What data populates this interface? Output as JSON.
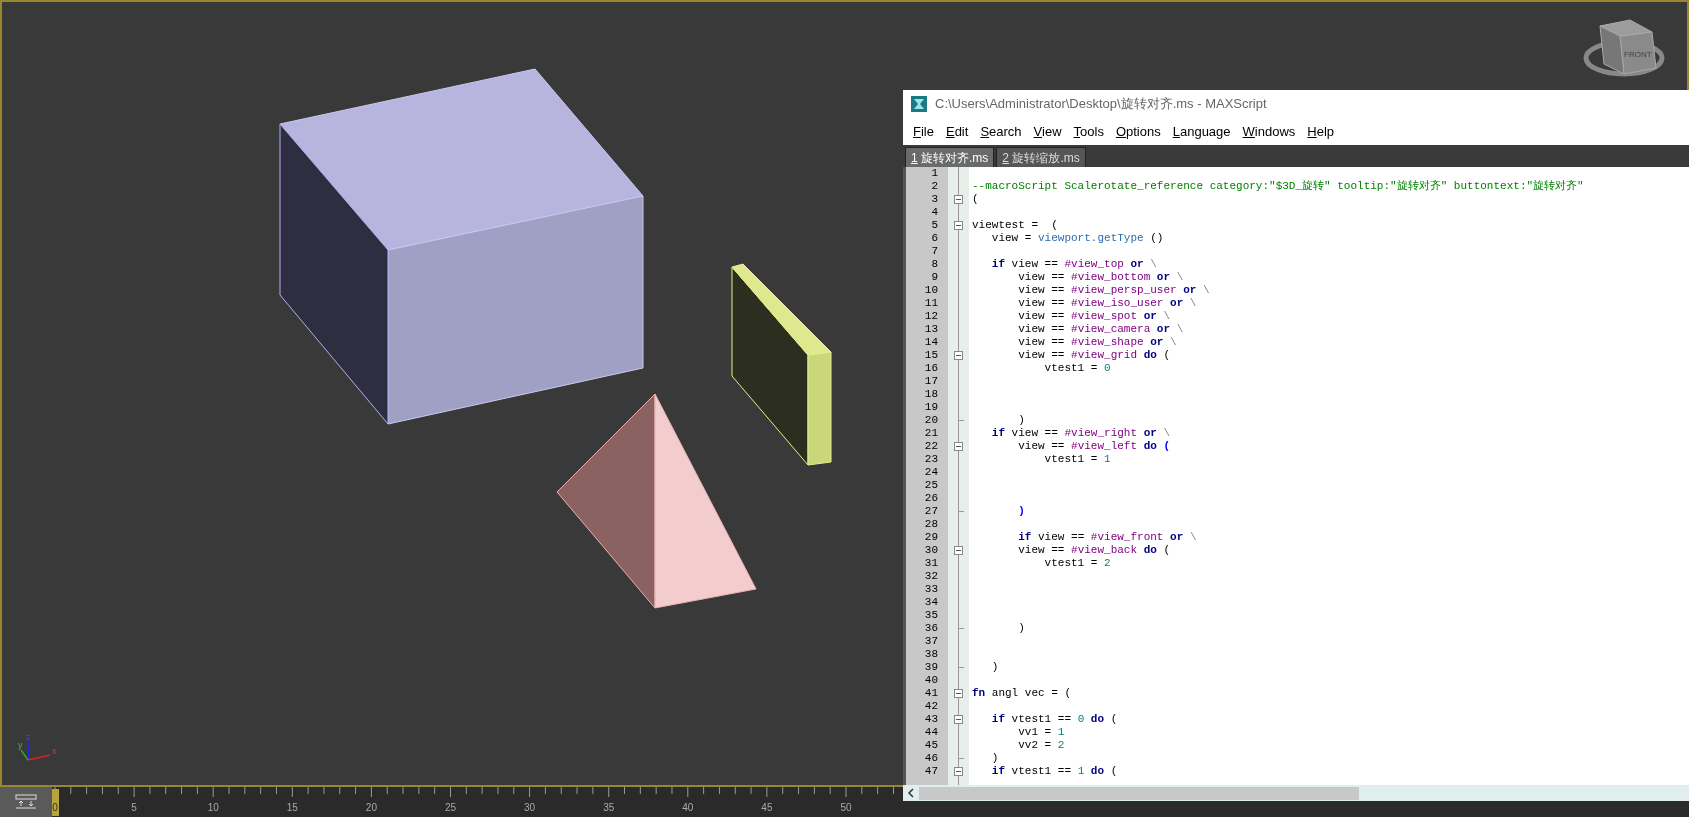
{
  "viewport": {
    "viewcube_label": "FRONT",
    "axis_labels": [
      "z",
      "y",
      "x"
    ]
  },
  "timeline": {
    "frame_labels": [
      "0",
      "5",
      "10",
      "15",
      "20",
      "25",
      "30",
      "35",
      "40",
      "45",
      "50"
    ],
    "time_slider": {
      "level": 0
    }
  },
  "editor": {
    "title": "C:\\Users\\Administrator\\Desktop\\旋转对齐.ms - MAXScript",
    "menu": [
      "File",
      "Edit",
      "Search",
      "View",
      "Tools",
      "Options",
      "Language",
      "Windows",
      "Help"
    ],
    "tabs": [
      {
        "number": "1",
        "label": " 旋转对齐.ms",
        "selected": true
      },
      {
        "number": "2",
        "label": " 旋转缩放.ms",
        "selected": false
      }
    ],
    "lines": [
      {
        "number": "1",
        "kind": "plain"
      },
      {
        "number": "2",
        "kind": "plain",
        "tokens": [
          {
            "kind": "comment",
            "text": "--macroScript Scalerotate_reference category:\"$3D_旋转\" tooltip:\"旋转对齐\" buttontext:\"旋转对齐\""
          }
        ]
      },
      {
        "number": "3",
        "kind": "fold-start",
        "tokens": [
          {
            "kind": "plain",
            "text": "("
          }
        ]
      },
      {
        "number": "4",
        "kind": "plain"
      },
      {
        "number": "5",
        "kind": "fold-start",
        "tokens": [
          {
            "kind": "plain",
            "text": "viewtest =  ("
          }
        ]
      },
      {
        "number": "6",
        "kind": "plain",
        "tokens": [
          {
            "kind": "plain",
            "text": "   view = "
          },
          {
            "kind": "call",
            "text": "viewport.getType"
          },
          {
            "kind": "plain",
            "text": " ()"
          }
        ]
      },
      {
        "number": "7",
        "kind": "plain"
      },
      {
        "number": "8",
        "kind": "plain",
        "tokens": [
          {
            "kind": "keyword",
            "text": "   if"
          },
          {
            "kind": "plain",
            "text": " view == "
          },
          {
            "kind": "symbol",
            "text": "#view_top"
          },
          {
            "kind": "keyword",
            "text": " or"
          },
          {
            "kind": "escape",
            "text": " \\"
          }
        ]
      },
      {
        "number": "9",
        "kind": "plain",
        "tokens": [
          {
            "kind": "plain",
            "text": "       view == "
          },
          {
            "kind": "symbol",
            "text": "#view_bottom"
          },
          {
            "kind": "keyword",
            "text": " or"
          },
          {
            "kind": "escape",
            "text": " \\"
          }
        ]
      },
      {
        "number": "10",
        "kind": "plain",
        "tokens": [
          {
            "kind": "plain",
            "text": "       view == "
          },
          {
            "kind": "symbol",
            "text": "#view_persp_user"
          },
          {
            "kind": "keyword",
            "text": " or"
          },
          {
            "kind": "escape",
            "text": " \\"
          }
        ]
      },
      {
        "number": "11",
        "kind": "plain",
        "tokens": [
          {
            "kind": "plain",
            "text": "       view == "
          },
          {
            "kind": "symbol",
            "text": "#view_iso_user"
          },
          {
            "kind": "keyword",
            "text": " or"
          },
          {
            "kind": "escape",
            "text": " \\"
          }
        ]
      },
      {
        "number": "12",
        "kind": "plain",
        "tokens": [
          {
            "kind": "plain",
            "text": "       view == "
          },
          {
            "kind": "symbol",
            "text": "#view_spot"
          },
          {
            "kind": "keyword",
            "text": " or"
          },
          {
            "kind": "escape",
            "text": " \\"
          }
        ]
      },
      {
        "number": "13",
        "kind": "plain",
        "tokens": [
          {
            "kind": "plain",
            "text": "       view == "
          },
          {
            "kind": "symbol",
            "text": "#view_camera"
          },
          {
            "kind": "keyword",
            "text": " or"
          },
          {
            "kind": "escape",
            "text": " \\"
          }
        ]
      },
      {
        "number": "14",
        "kind": "plain",
        "tokens": [
          {
            "kind": "plain",
            "text": "       view == "
          },
          {
            "kind": "symbol",
            "text": "#view_shape"
          },
          {
            "kind": "keyword",
            "text": " or"
          },
          {
            "kind": "escape",
            "text": " \\"
          }
        ]
      },
      {
        "number": "15",
        "kind": "fold-start",
        "tokens": [
          {
            "kind": "plain",
            "text": "       view == "
          },
          {
            "kind": "symbol",
            "text": "#view_grid"
          },
          {
            "kind": "keyword",
            "text": " do"
          },
          {
            "kind": "plain",
            "text": " ("
          }
        ]
      },
      {
        "number": "16",
        "kind": "plain",
        "tokens": [
          {
            "kind": "plain",
            "text": "           vtest1 = "
          },
          {
            "kind": "number",
            "text": "0"
          }
        ]
      },
      {
        "number": "17",
        "kind": "plain"
      },
      {
        "number": "18",
        "kind": "plain"
      },
      {
        "number": "19",
        "kind": "plain"
      },
      {
        "number": "20",
        "kind": "fold-end",
        "tokens": [
          {
            "kind": "plain",
            "text": "       )"
          }
        ]
      },
      {
        "number": "21",
        "kind": "plain",
        "tokens": [
          {
            "kind": "keyword",
            "text": "   if"
          },
          {
            "kind": "plain",
            "text": " view == "
          },
          {
            "kind": "symbol",
            "text": "#view_right"
          },
          {
            "kind": "keyword",
            "text": " or"
          },
          {
            "kind": "escape",
            "text": " \\"
          }
        ]
      },
      {
        "number": "22",
        "kind": "fold-start",
        "tokens": [
          {
            "kind": "plain",
            "text": "       view == "
          },
          {
            "kind": "symbol",
            "text": "#view_left"
          },
          {
            "kind": "keyword",
            "text": " do"
          },
          {
            "kind": "brace",
            "text": " ("
          }
        ]
      },
      {
        "number": "23",
        "kind": "plain",
        "tokens": [
          {
            "kind": "plain",
            "text": "           vtest1 = "
          },
          {
            "kind": "number",
            "text": "1"
          }
        ]
      },
      {
        "number": "24",
        "kind": "plain"
      },
      {
        "number": "25",
        "kind": "plain"
      },
      {
        "number": "26",
        "kind": "plain"
      },
      {
        "number": "27",
        "kind": "fold-end",
        "tokens": [
          {
            "kind": "brace",
            "text": "       )"
          }
        ]
      },
      {
        "number": "28",
        "kind": "plain"
      },
      {
        "number": "29",
        "kind": "plain",
        "tokens": [
          {
            "kind": "keyword",
            "text": "       if"
          },
          {
            "kind": "plain",
            "text": " view == "
          },
          {
            "kind": "symbol",
            "text": "#view_front"
          },
          {
            "kind": "keyword",
            "text": " or"
          },
          {
            "kind": "escape",
            "text": " \\"
          }
        ]
      },
      {
        "number": "30",
        "kind": "fold-start",
        "tokens": [
          {
            "kind": "plain",
            "text": "       view == "
          },
          {
            "kind": "symbol",
            "text": "#view_back"
          },
          {
            "kind": "keyword",
            "text": " do"
          },
          {
            "kind": "plain",
            "text": " ("
          }
        ]
      },
      {
        "number": "31",
        "kind": "plain",
        "tokens": [
          {
            "kind": "plain",
            "text": "           vtest1 = "
          },
          {
            "kind": "number",
            "text": "2"
          }
        ]
      },
      {
        "number": "32",
        "kind": "plain"
      },
      {
        "number": "33",
        "kind": "plain"
      },
      {
        "number": "34",
        "kind": "plain"
      },
      {
        "number": "35",
        "kind": "plain"
      },
      {
        "number": "36",
        "kind": "fold-end",
        "tokens": [
          {
            "kind": "plain",
            "text": "       )"
          }
        ]
      },
      {
        "number": "37",
        "kind": "plain"
      },
      {
        "number": "38",
        "kind": "plain"
      },
      {
        "number": "39",
        "kind": "fold-end",
        "tokens": [
          {
            "kind": "plain",
            "text": "   )"
          }
        ]
      },
      {
        "number": "40",
        "kind": "plain"
      },
      {
        "number": "41",
        "kind": "fold-start",
        "tokens": [
          {
            "kind": "keyword",
            "text": "fn"
          },
          {
            "kind": "plain",
            "text": " angl vec = ("
          }
        ]
      },
      {
        "number": "42",
        "kind": "plain"
      },
      {
        "number": "43",
        "kind": "fold-start",
        "tokens": [
          {
            "kind": "keyword",
            "text": "   if"
          },
          {
            "kind": "plain",
            "text": " vtest1 == "
          },
          {
            "kind": "number",
            "text": "0"
          },
          {
            "kind": "keyword",
            "text": " do"
          },
          {
            "kind": "plain",
            "text": " ("
          }
        ]
      },
      {
        "number": "44",
        "kind": "plain",
        "tokens": [
          {
            "kind": "plain",
            "text": "       vv1 = "
          },
          {
            "kind": "number",
            "text": "1"
          }
        ]
      },
      {
        "number": "45",
        "kind": "plain",
        "tokens": [
          {
            "kind": "plain",
            "text": "       vv2 = "
          },
          {
            "kind": "number",
            "text": "2"
          }
        ]
      },
      {
        "number": "46",
        "kind": "fold-end",
        "tokens": [
          {
            "kind": "plain",
            "text": "   )"
          }
        ]
      },
      {
        "number": "47",
        "kind": "fold-start",
        "tokens": [
          {
            "kind": "keyword",
            "text": "   if"
          },
          {
            "kind": "plain",
            "text": " vtest1 == "
          },
          {
            "kind": "number",
            "text": "1"
          },
          {
            "kind": "keyword",
            "text": " do"
          },
          {
            "kind": "plain",
            "text": " ("
          }
        ]
      }
    ]
  }
}
